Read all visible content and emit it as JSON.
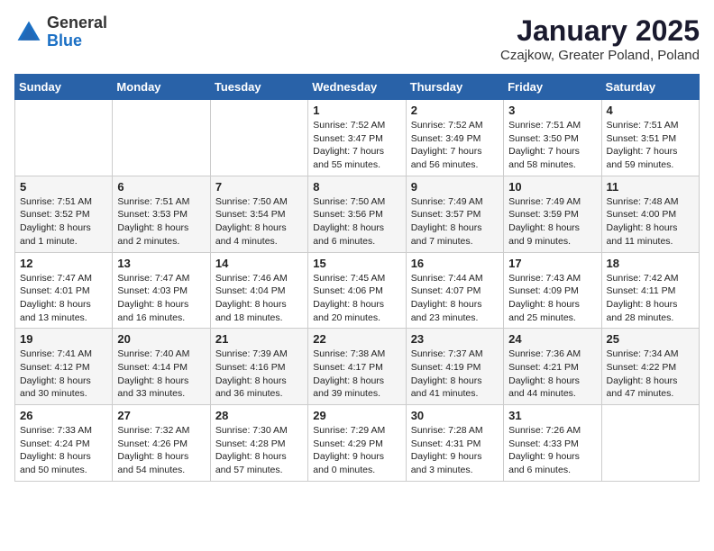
{
  "header": {
    "logo_general": "General",
    "logo_blue": "Blue",
    "month_title": "January 2025",
    "subtitle": "Czajkow, Greater Poland, Poland"
  },
  "weekdays": [
    "Sunday",
    "Monday",
    "Tuesday",
    "Wednesday",
    "Thursday",
    "Friday",
    "Saturday"
  ],
  "weeks": [
    [
      {
        "day": "",
        "info": ""
      },
      {
        "day": "",
        "info": ""
      },
      {
        "day": "",
        "info": ""
      },
      {
        "day": "1",
        "info": "Sunrise: 7:52 AM\nSunset: 3:47 PM\nDaylight: 7 hours and 55 minutes."
      },
      {
        "day": "2",
        "info": "Sunrise: 7:52 AM\nSunset: 3:49 PM\nDaylight: 7 hours and 56 minutes."
      },
      {
        "day": "3",
        "info": "Sunrise: 7:51 AM\nSunset: 3:50 PM\nDaylight: 7 hours and 58 minutes."
      },
      {
        "day": "4",
        "info": "Sunrise: 7:51 AM\nSunset: 3:51 PM\nDaylight: 7 hours and 59 minutes."
      }
    ],
    [
      {
        "day": "5",
        "info": "Sunrise: 7:51 AM\nSunset: 3:52 PM\nDaylight: 8 hours and 1 minute."
      },
      {
        "day": "6",
        "info": "Sunrise: 7:51 AM\nSunset: 3:53 PM\nDaylight: 8 hours and 2 minutes."
      },
      {
        "day": "7",
        "info": "Sunrise: 7:50 AM\nSunset: 3:54 PM\nDaylight: 8 hours and 4 minutes."
      },
      {
        "day": "8",
        "info": "Sunrise: 7:50 AM\nSunset: 3:56 PM\nDaylight: 8 hours and 6 minutes."
      },
      {
        "day": "9",
        "info": "Sunrise: 7:49 AM\nSunset: 3:57 PM\nDaylight: 8 hours and 7 minutes."
      },
      {
        "day": "10",
        "info": "Sunrise: 7:49 AM\nSunset: 3:59 PM\nDaylight: 8 hours and 9 minutes."
      },
      {
        "day": "11",
        "info": "Sunrise: 7:48 AM\nSunset: 4:00 PM\nDaylight: 8 hours and 11 minutes."
      }
    ],
    [
      {
        "day": "12",
        "info": "Sunrise: 7:47 AM\nSunset: 4:01 PM\nDaylight: 8 hours and 13 minutes."
      },
      {
        "day": "13",
        "info": "Sunrise: 7:47 AM\nSunset: 4:03 PM\nDaylight: 8 hours and 16 minutes."
      },
      {
        "day": "14",
        "info": "Sunrise: 7:46 AM\nSunset: 4:04 PM\nDaylight: 8 hours and 18 minutes."
      },
      {
        "day": "15",
        "info": "Sunrise: 7:45 AM\nSunset: 4:06 PM\nDaylight: 8 hours and 20 minutes."
      },
      {
        "day": "16",
        "info": "Sunrise: 7:44 AM\nSunset: 4:07 PM\nDaylight: 8 hours and 23 minutes."
      },
      {
        "day": "17",
        "info": "Sunrise: 7:43 AM\nSunset: 4:09 PM\nDaylight: 8 hours and 25 minutes."
      },
      {
        "day": "18",
        "info": "Sunrise: 7:42 AM\nSunset: 4:11 PM\nDaylight: 8 hours and 28 minutes."
      }
    ],
    [
      {
        "day": "19",
        "info": "Sunrise: 7:41 AM\nSunset: 4:12 PM\nDaylight: 8 hours and 30 minutes."
      },
      {
        "day": "20",
        "info": "Sunrise: 7:40 AM\nSunset: 4:14 PM\nDaylight: 8 hours and 33 minutes."
      },
      {
        "day": "21",
        "info": "Sunrise: 7:39 AM\nSunset: 4:16 PM\nDaylight: 8 hours and 36 minutes."
      },
      {
        "day": "22",
        "info": "Sunrise: 7:38 AM\nSunset: 4:17 PM\nDaylight: 8 hours and 39 minutes."
      },
      {
        "day": "23",
        "info": "Sunrise: 7:37 AM\nSunset: 4:19 PM\nDaylight: 8 hours and 41 minutes."
      },
      {
        "day": "24",
        "info": "Sunrise: 7:36 AM\nSunset: 4:21 PM\nDaylight: 8 hours and 44 minutes."
      },
      {
        "day": "25",
        "info": "Sunrise: 7:34 AM\nSunset: 4:22 PM\nDaylight: 8 hours and 47 minutes."
      }
    ],
    [
      {
        "day": "26",
        "info": "Sunrise: 7:33 AM\nSunset: 4:24 PM\nDaylight: 8 hours and 50 minutes."
      },
      {
        "day": "27",
        "info": "Sunrise: 7:32 AM\nSunset: 4:26 PM\nDaylight: 8 hours and 54 minutes."
      },
      {
        "day": "28",
        "info": "Sunrise: 7:30 AM\nSunset: 4:28 PM\nDaylight: 8 hours and 57 minutes."
      },
      {
        "day": "29",
        "info": "Sunrise: 7:29 AM\nSunset: 4:29 PM\nDaylight: 9 hours and 0 minutes."
      },
      {
        "day": "30",
        "info": "Sunrise: 7:28 AM\nSunset: 4:31 PM\nDaylight: 9 hours and 3 minutes."
      },
      {
        "day": "31",
        "info": "Sunrise: 7:26 AM\nSunset: 4:33 PM\nDaylight: 9 hours and 6 minutes."
      },
      {
        "day": "",
        "info": ""
      }
    ]
  ]
}
